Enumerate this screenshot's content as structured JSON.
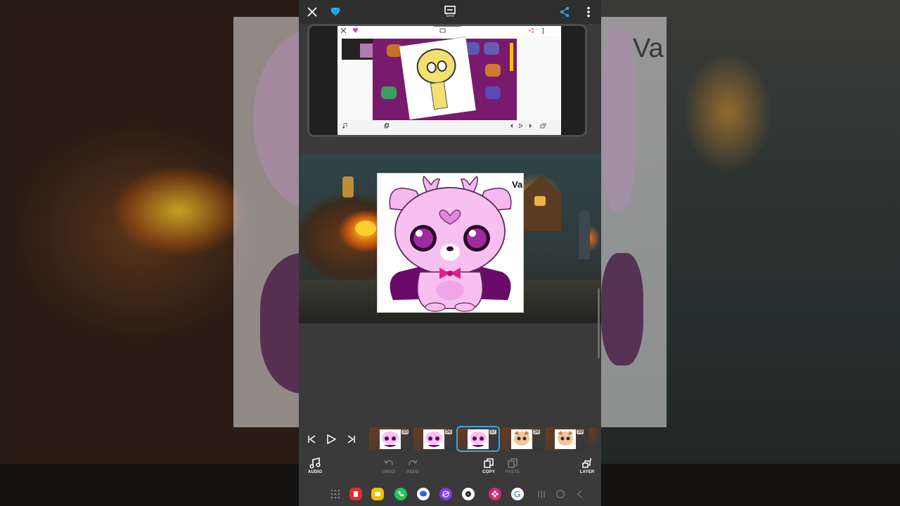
{
  "topbar": {
    "send_label": "Send"
  },
  "preview": {
    "sticker_text": "Va"
  },
  "background": {
    "side_text": "Va"
  },
  "timeline": {
    "frames": [
      {
        "num": "55"
      },
      {
        "num": "56"
      },
      {
        "num": "57"
      },
      {
        "num": "58"
      },
      {
        "num": "59"
      }
    ],
    "selected_index": 2
  },
  "toolbar": {
    "audio_label": "AUDIO",
    "undo_label": "UNDO",
    "redo_label": "REDO",
    "copy_label": "COPY",
    "paste_label": "PASTE",
    "layer_label": "LAYER"
  },
  "colors": {
    "accent": "#3aa6e0",
    "share": "#2aa0e8",
    "gem": "#29b6f6"
  }
}
